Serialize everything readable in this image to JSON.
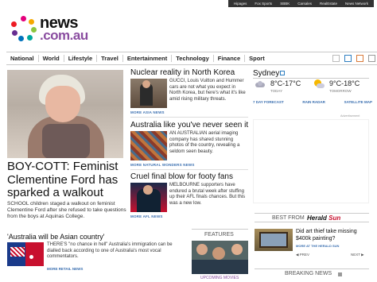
{
  "top_bar": {
    "links": [
      "Hipages",
      "Fox Sports",
      "SBBK",
      "Carsales",
      "RealEstate",
      "News Network"
    ]
  },
  "logo": {
    "word1": "news",
    "word2": ".com.au"
  },
  "nav": {
    "items": [
      "National",
      "World",
      "Lifestyle",
      "Travel",
      "Entertainment",
      "Technology",
      "Finance",
      "Sport"
    ]
  },
  "lead": {
    "title": "BOY-COTT: Feminist Clementine Ford has sparked a walkout",
    "text": "SCHOOL children staged a walkout on feminist Clementine Ford after she refused to take questions from the boys at Aquinas College."
  },
  "stories": [
    {
      "title": "Nuclear reality in North Korea",
      "text": "GUCCI, Louis Vuitton and Hummer cars are not what you expect in North Korea, but here's what it's like amid rising military threats.",
      "more": "MORE ASIA NEWS"
    },
    {
      "title": "Australia like you've never seen it",
      "text": "AN AUSTRALIAN aerial imaging company has shared stunning photos of the country, revealing a seldom seen beauty.",
      "more": "MORE NATURAL WONDERS NEWS"
    },
    {
      "title": "Cruel final blow for footy fans",
      "text": "MELBOURNE supporters have endured a brutal week after stuffing up their AFL finals chances. But this was a new low.",
      "more": "MORE AFL NEWS"
    }
  ],
  "weather": {
    "city": "Sydney",
    "today": {
      "temp": "8°C-17°C",
      "label": "TODAY"
    },
    "tomorrow": {
      "temp": "9°C-18°C",
      "label": "TOMORROW"
    },
    "links": [
      "7 DAY FORECAST",
      "RAIN RADAR",
      "SATELLITE MAP"
    ]
  },
  "advertisement_label": "Advertisement",
  "herald_sun": {
    "label": "BEST FROM",
    "brand_a": "Herald",
    "brand_b": "Sun",
    "headline": "Did art thief take missing $400k painting?",
    "more": "MORE AT THE HERALD SUN",
    "prev": "PREV",
    "next": "NEXT"
  },
  "breaking": {
    "label": "BREAKING NEWS"
  },
  "asian_story": {
    "title": "'Australia will be Asian country'",
    "text": "THERE'S \"no chance in hell\" Australia's immigration can be dialled back according to one of Australia's most vocal commentators.",
    "more": "MORE RETAIL NEWS"
  },
  "features": {
    "label": "FEATURES",
    "caption": "UPCOMING MOVIES"
  }
}
